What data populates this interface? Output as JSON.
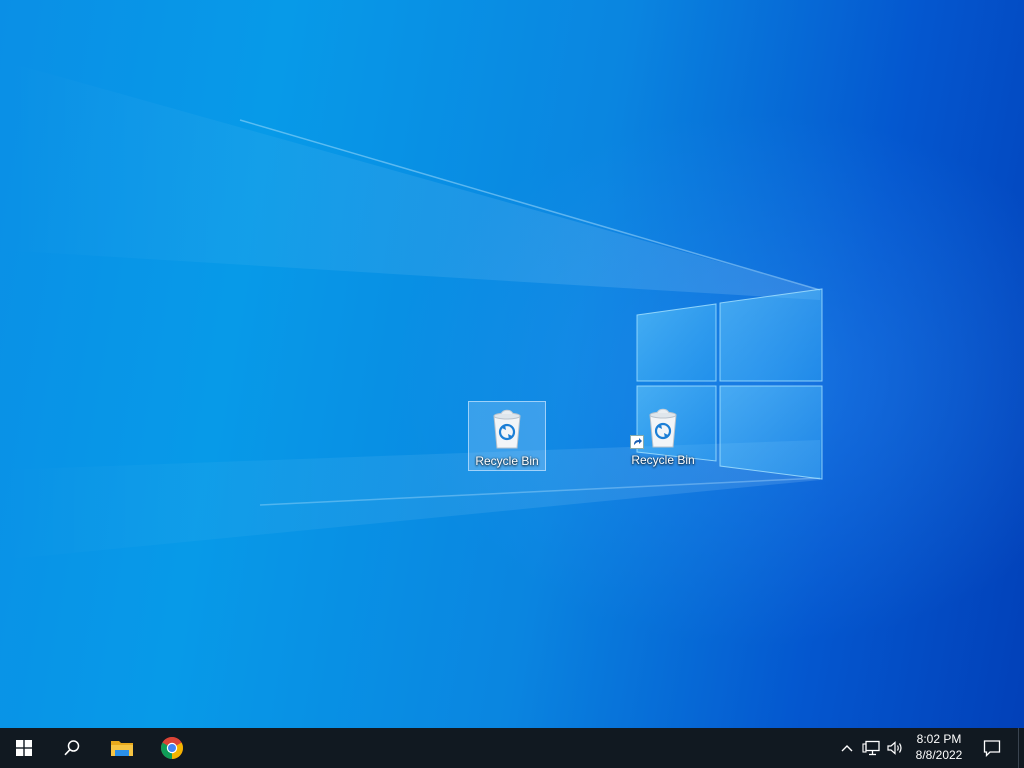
{
  "desktop": {
    "icons": [
      {
        "label": "Recycle Bin",
        "icon": "recycle-bin-icon",
        "selected": true,
        "shortcut": false
      },
      {
        "label": "Recycle Bin",
        "icon": "recycle-bin-icon",
        "selected": false,
        "shortcut": true
      }
    ]
  },
  "taskbar": {
    "start": {
      "icon": "windows-logo-icon"
    },
    "search": {
      "icon": "search-icon"
    },
    "pinned": [
      {
        "icon": "file-explorer-icon"
      },
      {
        "icon": "chrome-icon"
      }
    ],
    "tray": {
      "icons": [
        "chevron-up-icon",
        "network-icon",
        "volume-icon"
      ],
      "time": "8:02 PM",
      "date": "8/8/2022",
      "notification_icon": "action-center-icon"
    }
  },
  "colors": {
    "taskbar": "#111921",
    "wallpaper_light": "#079ae8",
    "wallpaper_dark": "#0240b8"
  }
}
